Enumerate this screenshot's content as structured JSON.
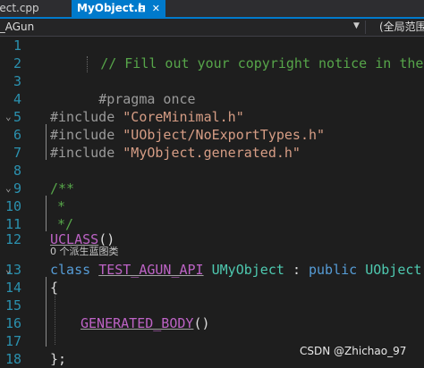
{
  "tabs": [
    {
      "label": "ject.cpp",
      "active": false
    },
    {
      "label": "MyObject.h",
      "active": true,
      "pin_icon": "pin-icon",
      "close_icon": "close-icon"
    }
  ],
  "nav": {
    "project": "t_AGun",
    "scope": "(全局范围)"
  },
  "line_numbers": [
    "1",
    "2",
    "3",
    "4",
    "5",
    "6",
    "7",
    "8",
    "9",
    "10",
    "11",
    "12",
    "13",
    "14",
    "15",
    "16",
    "17",
    "18"
  ],
  "code": {
    "l1": "// Fill out your copyright notice in the Descript",
    "l3": "#pragma once",
    "l5_pre": "#include",
    "l5_str": "\"CoreMinimal.h\"",
    "l6_pre": "#include",
    "l6_str": "\"UObject/NoExportTypes.h\"",
    "l7_pre": "#include",
    "l7_str": "\"MyObject.generated.h\"",
    "l9": "/**",
    "l10": "*",
    "l11": "*/",
    "l12_mac": "UCLASS",
    "l12_rest": "()",
    "codelens": "0 个派生蓝图类",
    "l13_kw": "class",
    "l13_mac": "TEST_AGUN_API",
    "l13_type": "UMyObject",
    "l13_colon": ":",
    "l13_kw2": "public",
    "l13_base": "UObject",
    "l14": "{",
    "l16_mac": "GENERATED_BODY",
    "l16_rest": "()",
    "l18": "};"
  },
  "watermark": "CSDN @Zhichao_97"
}
